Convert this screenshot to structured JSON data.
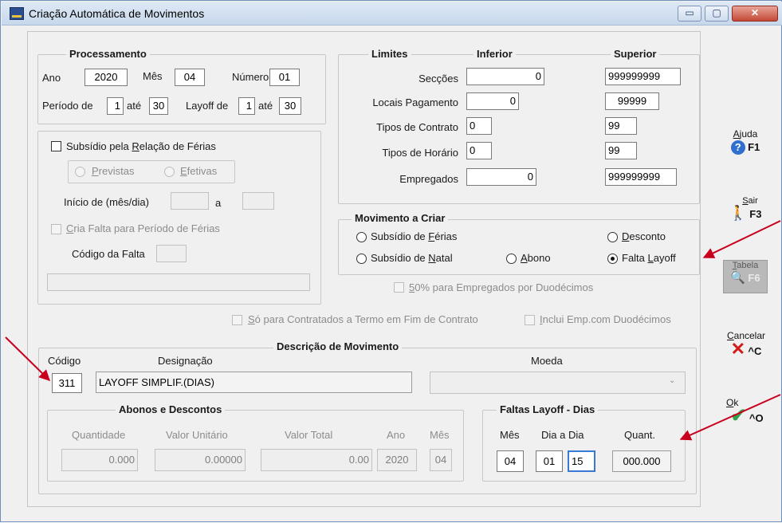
{
  "window": {
    "title": "Criação Automática de Movimentos",
    "controls": {
      "minimize": "▭",
      "maximize": "▢",
      "close": "✕"
    }
  },
  "processamento": {
    "legend": "Processamento",
    "ano_label": "Ano",
    "ano": "2020",
    "mes_label": "Mês",
    "mes": "04",
    "numero_label": "Número",
    "numero": "01",
    "periodo_de_label": "Período de",
    "periodo_de": "1",
    "ate_label": "até",
    "periodo_ate": "30",
    "layoff_de_label": "Layoff de",
    "layoff_de": "1",
    "layoff_ate_label": "até",
    "layoff_ate": "30"
  },
  "subsidio": {
    "checkbox_prefix": "Subsídio pela ",
    "checkbox_u": "R",
    "checkbox_suffix": "elação de Férias",
    "previstas_u": "P",
    "previstas_rest": "revistas",
    "efetivas_u": "E",
    "efetivas_rest": "fetivas",
    "inicio_label": "Início de (mês/dia)",
    "a_label": "a",
    "cria_falta_u": "C",
    "cria_falta_rest": "ria Falta para Período de Férias",
    "codigo_falta_label": "Código da Falta"
  },
  "limites": {
    "legend": "Limites",
    "inferior_label": "Inferior",
    "superior_label": "Superior",
    "rows": [
      {
        "label": "Secções",
        "inferior": "0",
        "superior": "999999999"
      },
      {
        "label": "Locais Pagamento",
        "inferior": "0",
        "superior": "99999"
      },
      {
        "label": "Tipos de Contrato",
        "inferior": "0",
        "superior": "99"
      },
      {
        "label": "Tipos de Horário",
        "inferior": "0",
        "superior": "99"
      },
      {
        "label": "Empregados",
        "inferior": "0",
        "superior": "999999999"
      }
    ]
  },
  "movimento_criar": {
    "legend": "Movimento a Criar",
    "options": [
      {
        "pre": "Subsídio de ",
        "u": "F",
        "post": "érias"
      },
      {
        "pre": "",
        "u": "D",
        "post": "esconto"
      },
      {
        "pre": "Subsídio de ",
        "u": "N",
        "post": "atal"
      },
      {
        "pre": "",
        "u": "A",
        "post": "bono"
      },
      {
        "pre": "Falta ",
        "u": "L",
        "post": "ayoff"
      }
    ],
    "selected": "Falta Layoff"
  },
  "duodecimos": {
    "empregados_u": "5",
    "empregados_rest": "0% para Empregados por Duodécimos",
    "contratados_u": "S",
    "contratados_rest": "ó para Contratados a Termo em Fim de Contrato",
    "inclui_u": "I",
    "inclui_rest": "nclui Emp.com Duodécimos"
  },
  "descricao": {
    "legend": "Descrição de Movimento",
    "codigo_label": "Código",
    "codigo": "311",
    "designacao_label": "Designação",
    "designacao": "LAYOFF SIMPLIF.(DIAS)",
    "moeda_label": "Moeda",
    "moeda": ""
  },
  "abonos": {
    "legend": "Abonos e Descontos",
    "quantidade_label": "Quantidade",
    "quantidade": "0.000",
    "valor_unitario_label": "Valor Unitário",
    "valor_unitario": "0.00000",
    "valor_total_label": "Valor Total",
    "valor_total": "0.00",
    "ano_label": "Ano",
    "ano": "2020",
    "mes_label": "Mês",
    "mes": "04"
  },
  "faltas_layoff": {
    "legend": "Faltas Layoff - Dias",
    "mes_label": "Mês",
    "mes": "04",
    "dia_a_dia_label": "Dia a Dia",
    "dia_de": "01",
    "dia_ate": "15",
    "quant_label": "Quant.",
    "quant": "000.000"
  },
  "toolbar": {
    "ajuda_u": "A",
    "ajuda_rest": "juda",
    "ajuda_key": "F1",
    "sair_u": "S",
    "sair_rest": "air",
    "sair_key": "F3",
    "tabela_u": "T",
    "tabela_rest": "abela",
    "tabela_key": "F6",
    "cancelar_u": "C",
    "cancelar_rest": "ancelar",
    "cancelar_key": "^C",
    "ok_u": "O",
    "ok_rest": "k",
    "ok_key": "^O"
  },
  "annotation_color": "#c8001e"
}
